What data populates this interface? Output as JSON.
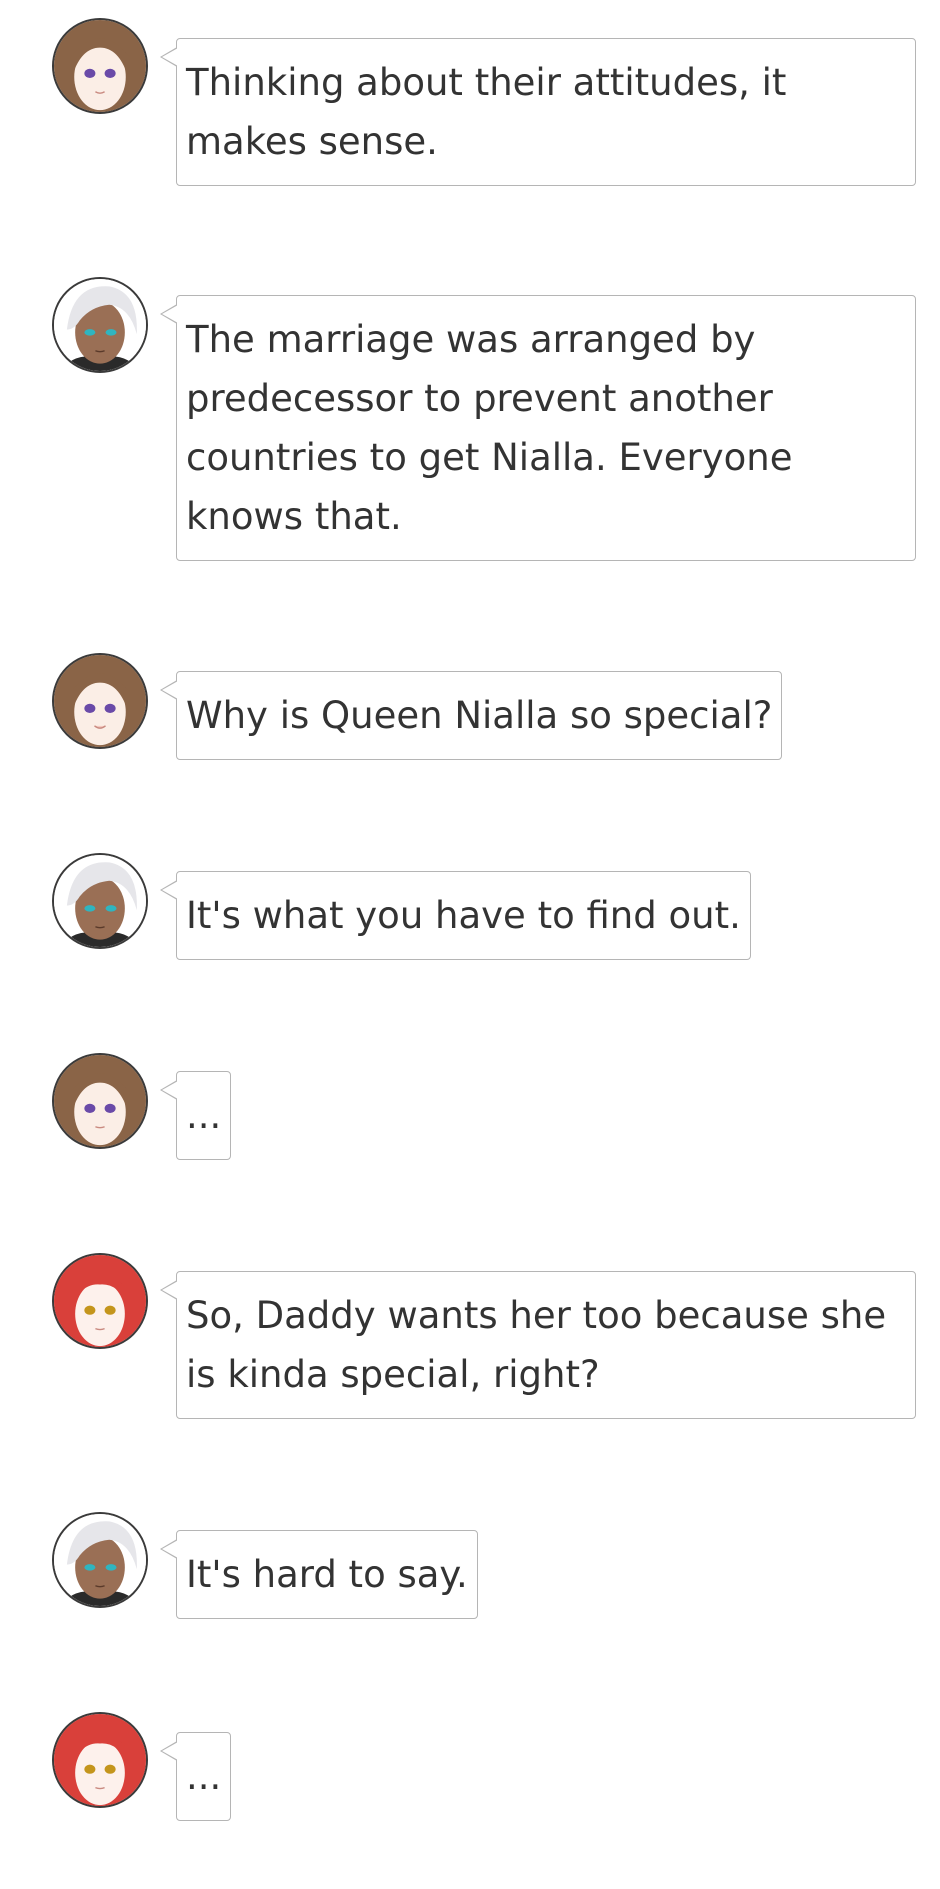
{
  "messages": [
    {
      "speaker": "brown-haired-girl",
      "text": "Thinking about their attitudes, it makes sense."
    },
    {
      "speaker": "white-haired-man",
      "text": "The marriage was arranged by predecessor to prevent another countries to get Nialla. Everyone knows that."
    },
    {
      "speaker": "brown-haired-girl",
      "text": "Why is Queen Nialla so special?"
    },
    {
      "speaker": "white-haired-man",
      "text": "It's what you have to find out."
    },
    {
      "speaker": "brown-haired-girl",
      "text": "..."
    },
    {
      "speaker": "red-haired-girl",
      "text": "So, Daddy wants her too because she is kinda special, right?"
    },
    {
      "speaker": "white-haired-man",
      "text": "It's hard to say."
    },
    {
      "speaker": "red-haired-girl",
      "text": "..."
    }
  ],
  "colors": {
    "bubble_border": "#b5b5b5",
    "text": "#333333",
    "brown_hair": "#8a6447",
    "white_hair": "#e6e6ea",
    "red_hair": "#d9403a"
  }
}
